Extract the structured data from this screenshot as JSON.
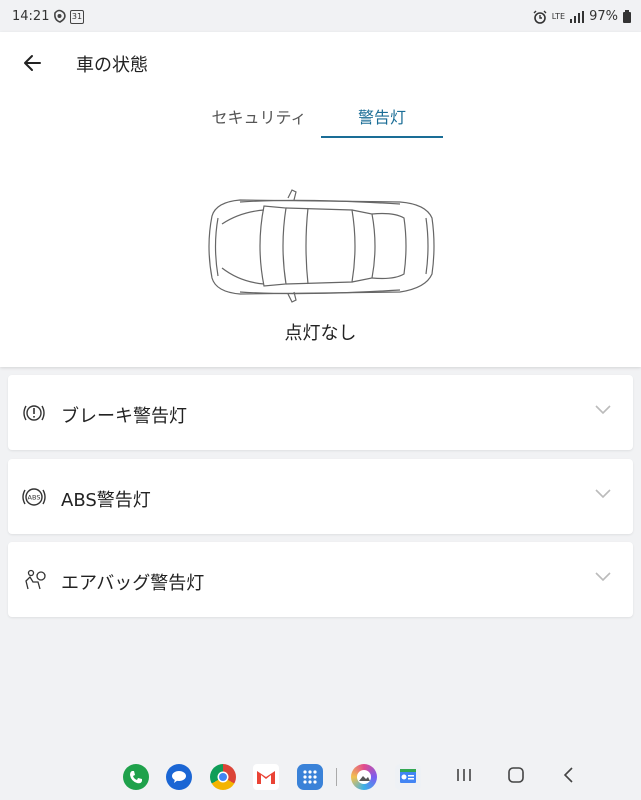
{
  "status_bar": {
    "time": "14:21",
    "calendar_day": "31",
    "network": "LTE",
    "battery": "97%"
  },
  "header": {
    "title": "車の状態"
  },
  "tabs": [
    {
      "label": "セキュリティ",
      "selected": false
    },
    {
      "label": "警告灯",
      "selected": true
    }
  ],
  "car_status": {
    "text": "点灯なし"
  },
  "warnings": [
    {
      "label": "ブレーキ警告灯",
      "icon": "brake-warning-icon"
    },
    {
      "label": "ABS警告灯",
      "icon": "abs-warning-icon"
    },
    {
      "label": "エアバッグ警告灯",
      "icon": "airbag-warning-icon"
    }
  ],
  "abs_icon_text": "ABS",
  "dock_apps": [
    "phone",
    "messages",
    "chrome",
    "gmail",
    "app-drawer",
    "gallery",
    "news"
  ],
  "colors": {
    "accent": "#1a6d96",
    "background": "#f1f2f4"
  }
}
